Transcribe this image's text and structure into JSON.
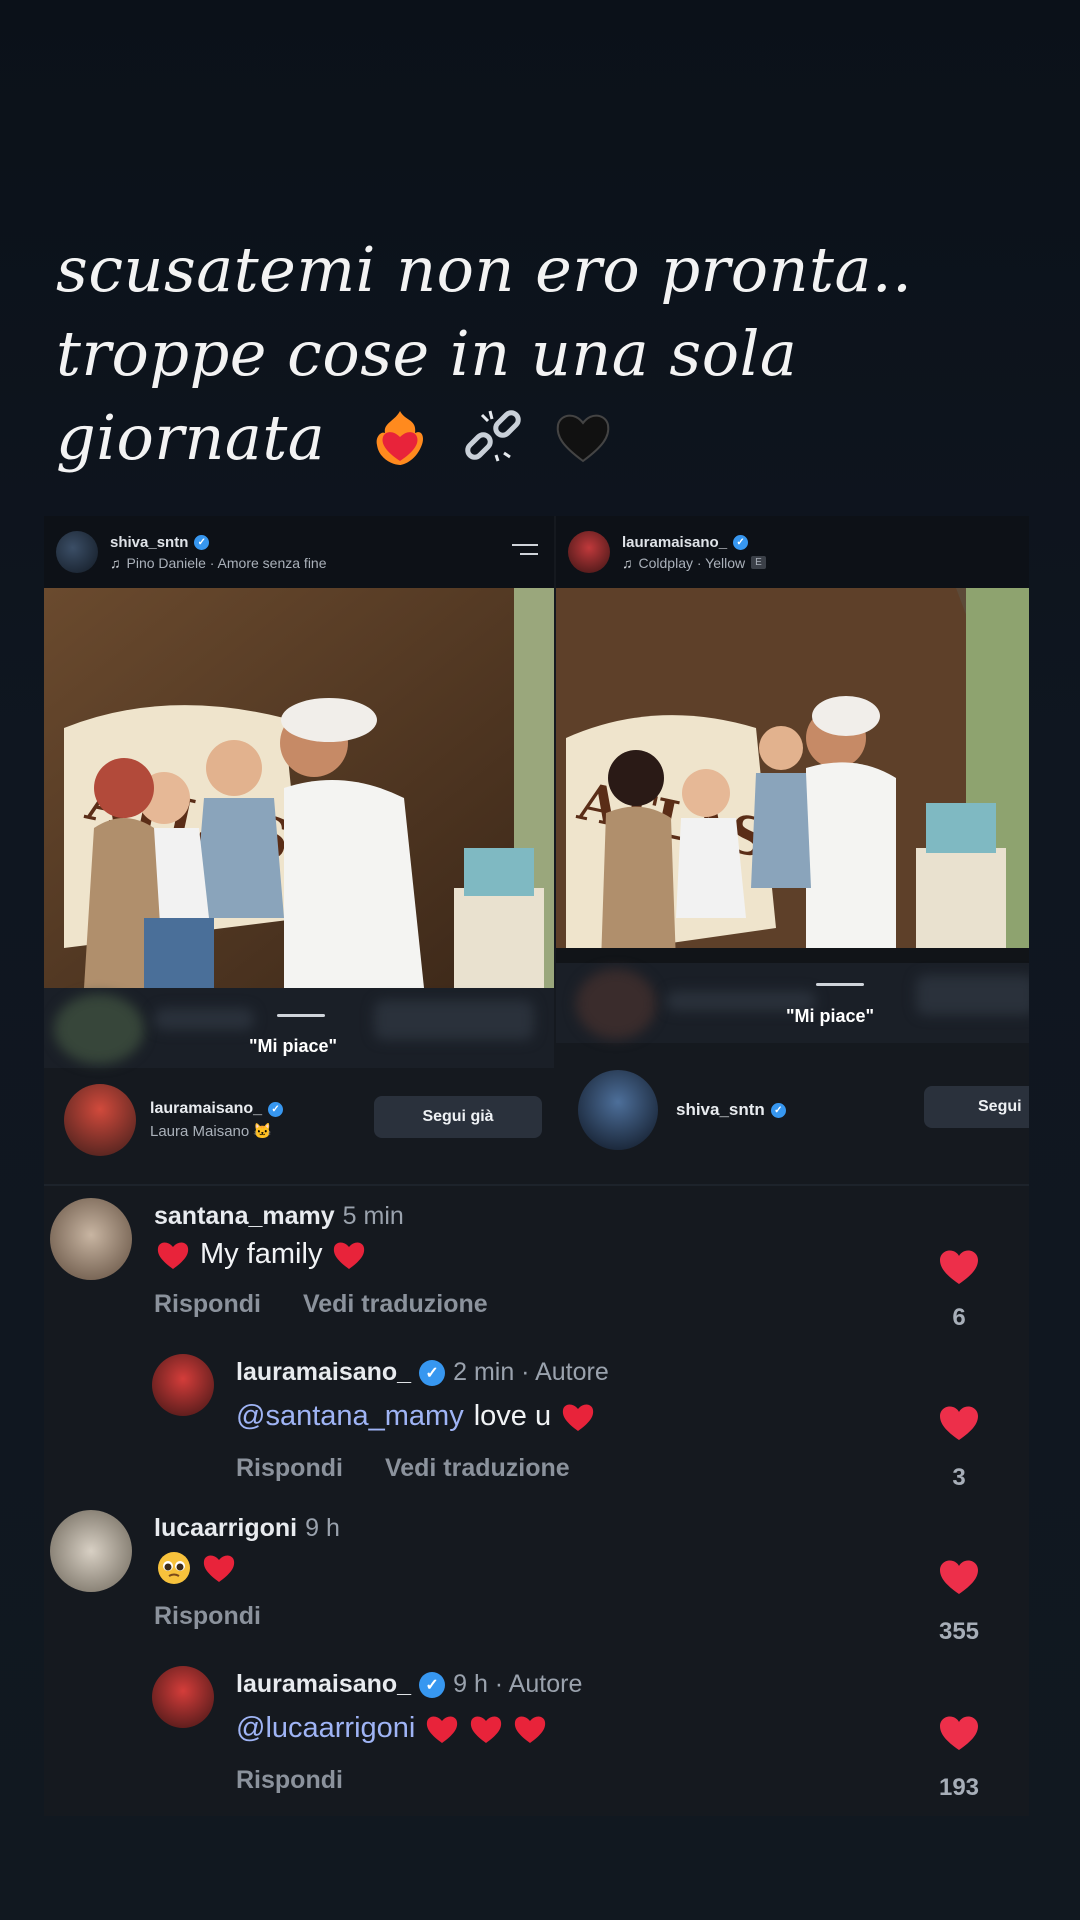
{
  "caption": {
    "line1": "scusatemi non ero pronta..",
    "line2": "troppe cose in una sola",
    "line3": "giornata"
  },
  "left_post": {
    "username": "shiva_sntn",
    "song": "Pino Daniele · Amore senza fine",
    "mi_piace": "\"Mi piace\"",
    "liker_username": "lauramaisano_",
    "liker_fullname": "Laura Maisano 🐱",
    "follow_button": "Segui già"
  },
  "right_post": {
    "username": "lauramaisano_",
    "song": "Coldplay · Yellow",
    "explicit": "E",
    "mi_piace": "\"Mi piace\"",
    "liker_username": "shiva_sntn",
    "follow_button": "Segui"
  },
  "comments": [
    {
      "user": "santana_mamy",
      "time": "5 min",
      "text": "My family",
      "actions": [
        "Rispondi",
        "Vedi traduzione"
      ],
      "likes": "6"
    },
    {
      "user": "lauramaisano_",
      "time": "2 min · Autore",
      "mention": "@santana_mamy",
      "text": "love u",
      "actions": [
        "Rispondi",
        "Vedi traduzione"
      ],
      "likes": "3"
    },
    {
      "user": "lucaarrigoni",
      "time": "9 h",
      "actions": [
        "Rispondi"
      ],
      "likes": "355"
    },
    {
      "user": "lauramaisano_",
      "time": "9 h · Autore",
      "mention": "@lucaarrigoni",
      "actions": [
        "Rispondi"
      ],
      "likes": "193"
    }
  ],
  "colors": {
    "heart": "#ed2f4a",
    "verified": "#3797f0",
    "mention": "#9fb4f5"
  }
}
